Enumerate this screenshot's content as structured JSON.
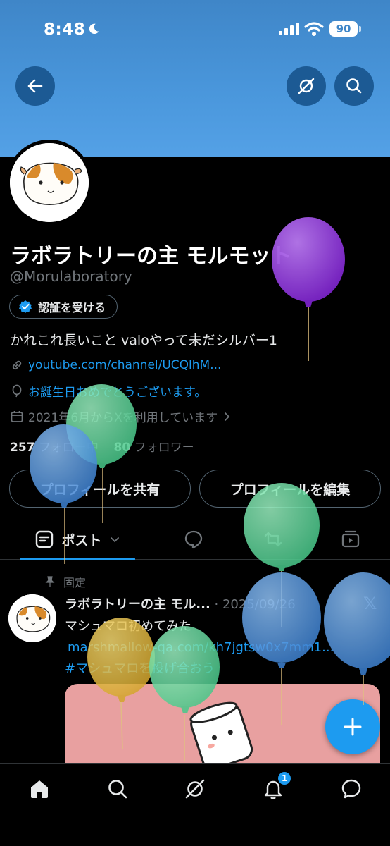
{
  "status": {
    "time": "8:48",
    "battery": "90"
  },
  "header": {
    "back_icon": "arrow-left-icon",
    "grok_icon": "grok-icon",
    "search_icon": "search-icon",
    "banner_color": "#4a97dc"
  },
  "profile": {
    "display_name": "ラボラトリーの主 モルモット",
    "handle": "@Morulaboratory",
    "verify_label": "認証を受ける",
    "bio": "かれこれ長いこと valoやって未だシルバー1",
    "link": "youtube.com/channel/UCQlhM...",
    "birthday": "お誕生日おめでとうございます。",
    "joined": "2021年6月からXを利用しています",
    "following_count": "257",
    "following_label": "フォロー中",
    "followers_count": "80",
    "followers_label": "フォロワー",
    "share_label": "プロフィールを共有",
    "edit_label": "プロフィールを編集"
  },
  "tabs": {
    "posts_label": "ポスト",
    "accent": "#1d9bf0"
  },
  "post": {
    "pinned_label": "固定",
    "author": "ラボラトリーの主 モル...",
    "date": "· 2025/09/26",
    "text": "マシュマロ初めてみた",
    "link": "marshmallow-qa.com/kh7jgtsw0x7mm1...",
    "hashtag": "#マシュマロを投げ合おう"
  },
  "nav": {
    "notification_count": "1"
  }
}
